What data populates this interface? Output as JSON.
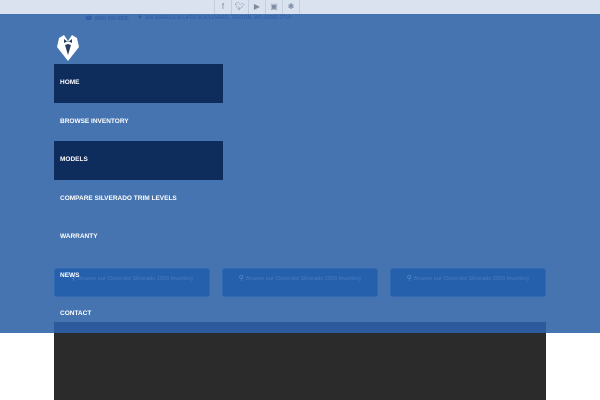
{
  "social_icons": [
    "facebook-icon",
    "twitter-icon",
    "youtube-icon",
    "instagram-icon",
    "yelp-icon"
  ],
  "contact": {
    "phone": "(888) 660-6826",
    "address": "109 ISRAELS BLUFFS BOULEVARD, TENTON, WO 00000-2719"
  },
  "nav": [
    {
      "label": "HOME",
      "active": true
    },
    {
      "label": "BROWSE INVENTORY",
      "active": false
    },
    {
      "label": "MODELS",
      "active": true
    },
    {
      "label": "COMPARE SILVERADO TRIM LEVELS",
      "active": false
    },
    {
      "label": "WARRANTY",
      "active": false
    },
    {
      "label": "NEWS",
      "active": false
    },
    {
      "label": "CONTACT",
      "active": false
    }
  ],
  "search_buttons": [
    "Browse our Chevrolet Silverado 1500 Inventory",
    "Browse our Chevrolet Silverado 2500 Inventory",
    "Browse our Chevrolet Silverado 3500 Inventory"
  ],
  "colors": {
    "hero_bg": "#4574b0",
    "nav_active": "#0f2d5c",
    "dark_panel": "#2b2b2b",
    "button_bg": "#2560ad"
  }
}
